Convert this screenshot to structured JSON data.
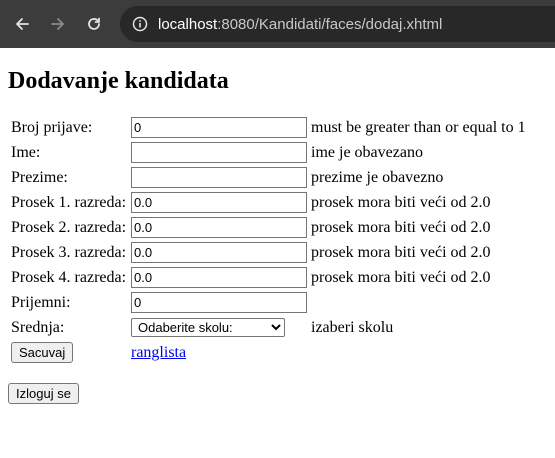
{
  "browser": {
    "url_host": "localhost",
    "url_rest": ":8080/Kandidati/faces/dodaj.xhtml"
  },
  "page": {
    "title": "Dodavanje kandidata"
  },
  "form": {
    "rows": [
      {
        "label": "Broj prijave:",
        "value": "0",
        "message": "must be greater than or equal to 1"
      },
      {
        "label": "Ime:",
        "value": "",
        "message": "ime je obavezano"
      },
      {
        "label": "Prezime:",
        "value": "",
        "message": "prezime je obavezno"
      },
      {
        "label": "Prosek 1. razreda:",
        "value": "0.0",
        "message": "prosek mora biti veći od 2.0"
      },
      {
        "label": "Prosek 2. razreda:",
        "value": "0.0",
        "message": "prosek mora biti veći od 2.0"
      },
      {
        "label": "Prosek 3. razreda:",
        "value": "0.0",
        "message": "prosek mora biti veći od 2.0"
      },
      {
        "label": "Prosek 4. razreda:",
        "value": "0.0",
        "message": "prosek mora biti veći od 2.0"
      },
      {
        "label": "Prijemni:",
        "value": "0",
        "message": ""
      }
    ],
    "school": {
      "label": "Srednja:",
      "selected": "Odaberite skolu:",
      "message": "izaberi skolu"
    },
    "save_label": "Sacuvaj",
    "ranking_link": "ranglista"
  },
  "logout_label": "Izloguj se"
}
